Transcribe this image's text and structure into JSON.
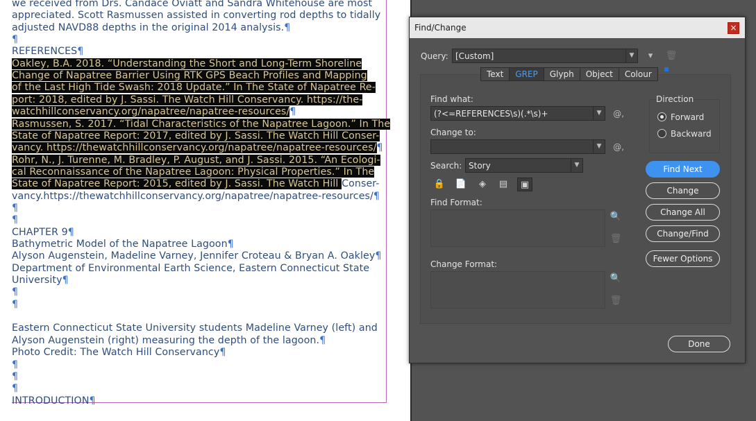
{
  "document": {
    "lines": [
      {
        "pre": "we received from Drs. Candace Oviatt and Sandra Whitehouse are most",
        "hl": "",
        "post": "",
        "pilcrow": ""
      },
      {
        "pre": "appreciated. Scott Rasmussen assisted in converting rod depths to tidally",
        "hl": "",
        "post": "",
        "pilcrow": ""
      },
      {
        "pre": "adjusted NAVD88 depths in the original 2014 analysis.",
        "hl": "",
        "post": "",
        "pilcrow": "¶"
      },
      {
        "pre": "",
        "hl": "",
        "post": "",
        "pilcrow": "¶"
      },
      {
        "pre": "REFERENCES",
        "hl": "",
        "post": "",
        "pilcrow": "¶"
      },
      {
        "pre": "",
        "hl": "Oakley, B.A. 2018. “Understanding the Short and Long-Term Shoreline",
        "post": "",
        "pilcrow": ""
      },
      {
        "pre": "",
        "hl": "Change of Napatree Barrier Using RTK GPS Beach Profiles and Mapping",
        "post": "",
        "pilcrow": ""
      },
      {
        "pre": "",
        "hl": "of the Last High Tide Swash: 2018 Update.” In The State of Napatree Re-",
        "post": "",
        "pilcrow": ""
      },
      {
        "pre": "",
        "hl": "port: 2018, edited by J. Sassi. The Watch Hill Conservancy. https://the-",
        "post": "",
        "pilcrow": ""
      },
      {
        "pre": "",
        "hl": "watchhillconservancy.org/napatree/napatree-resources/",
        "post": "",
        "pilcrow": "¶"
      },
      {
        "pre": "",
        "hl": "Rasmussen, S. 2017. “Tidal Characteristics of the Napatree Lagoon.” In The",
        "post": "",
        "pilcrow": ""
      },
      {
        "pre": "",
        "hl": "State of Napatree Report: 2017, edited by J. Sassi. The Watch Hill Conser-",
        "post": "",
        "pilcrow": ""
      },
      {
        "pre": "",
        "hl": "vancy. https://thewatchhillconservancy.org/napatree/napatree-resources/",
        "post": "",
        "pilcrow": "¶"
      },
      {
        "pre": "",
        "hl": "Rohr, N., J. Turenne, M. Bradley, P. August, and J. Sassi. 2015. “An Ecologi-",
        "post": "",
        "pilcrow": ""
      },
      {
        "pre": "",
        "hl": "cal Reconnaissance of the Napatree Lagoon: Physical Properties.” In The",
        "post": "",
        "pilcrow": ""
      },
      {
        "pre": "",
        "hl": "State of Napatree Report: 2015, edited by J. Sassi. The Watch Hill ",
        "post": "Conser-",
        "pilcrow": ""
      },
      {
        "pre": "vancy.https://thewatchhillconservancy.org/napatree/napatree-resources/",
        "hl": "",
        "post": "",
        "pilcrow": "¶"
      },
      {
        "pre": "",
        "hl": "",
        "post": "",
        "pilcrow": "¶"
      },
      {
        "pre": "",
        "hl": "",
        "post": "",
        "pilcrow": "¶"
      },
      {
        "pre": "CHAPTER 9",
        "hl": "",
        "post": "",
        "pilcrow": "¶"
      },
      {
        "pre": "Bathymetric Model of the Napatree Lagoon",
        "hl": "",
        "post": "",
        "pilcrow": "¶"
      },
      {
        "pre": "Alyson Augenstein, Madeline Varney, Jennifer Croteau & Bryan A. Oakley",
        "hl": "",
        "post": "",
        "pilcrow": "¶"
      },
      {
        "pre": "Department of Environmental Earth Science, Eastern Connecticut State",
        "hl": "",
        "post": "",
        "pilcrow": ""
      },
      {
        "pre": "University",
        "hl": "",
        "post": "",
        "pilcrow": "¶"
      },
      {
        "pre": "",
        "hl": "",
        "post": "",
        "pilcrow": "¶"
      },
      {
        "pre": "",
        "hl": "",
        "post": "",
        "pilcrow": "¶"
      },
      {
        "pre": "",
        "hl": "",
        "post": "",
        "pilcrow": ""
      },
      {
        "pre": "Eastern Connecticut State University students Madeline Varney (left) and",
        "hl": "",
        "post": "",
        "pilcrow": ""
      },
      {
        "pre": "Alyson Augenstein (right) measuring the depth of the lagoon.",
        "hl": "",
        "post": "",
        "pilcrow": "¶"
      },
      {
        "pre": "Photo Credit: The Watch Hill Conservancy",
        "hl": "",
        "post": "",
        "pilcrow": "¶"
      },
      {
        "pre": "",
        "hl": "",
        "post": "",
        "pilcrow": "¶"
      },
      {
        "pre": "",
        "hl": "",
        "post": "",
        "pilcrow": "¶"
      },
      {
        "pre": "",
        "hl": "",
        "post": "",
        "pilcrow": "¶"
      },
      {
        "pre": "INTRODUCTION",
        "hl": "",
        "post": "",
        "pilcrow": "¶"
      }
    ]
  },
  "dialog": {
    "title": "Find/Change",
    "close_glyph": "×",
    "query_label": "Query:",
    "query_value": "[Custom]",
    "tabs": [
      "Text",
      "GREP",
      "Glyph",
      "Object",
      "Colour"
    ],
    "active_tab": "GREP",
    "find_what_label": "Find what:",
    "find_what_value": "(?<=REFERENCES\\s)(.*\\s)+",
    "change_to_label": "Change to:",
    "change_to_value": "",
    "search_label": "Search:",
    "search_value": "Story",
    "find_format_label": "Find Format:",
    "change_format_label": "Change Format:",
    "direction_label": "Direction",
    "direction_options": [
      "Forward",
      "Backward"
    ],
    "direction_selected": "Forward",
    "buttons": {
      "find_next": "Find Next",
      "change": "Change",
      "change_all": "Change All",
      "change_find": "Change/Find",
      "fewer_options": "Fewer Options",
      "done": "Done"
    },
    "special_char_glyph": "@,",
    "accent_color": "#3f93f0"
  }
}
